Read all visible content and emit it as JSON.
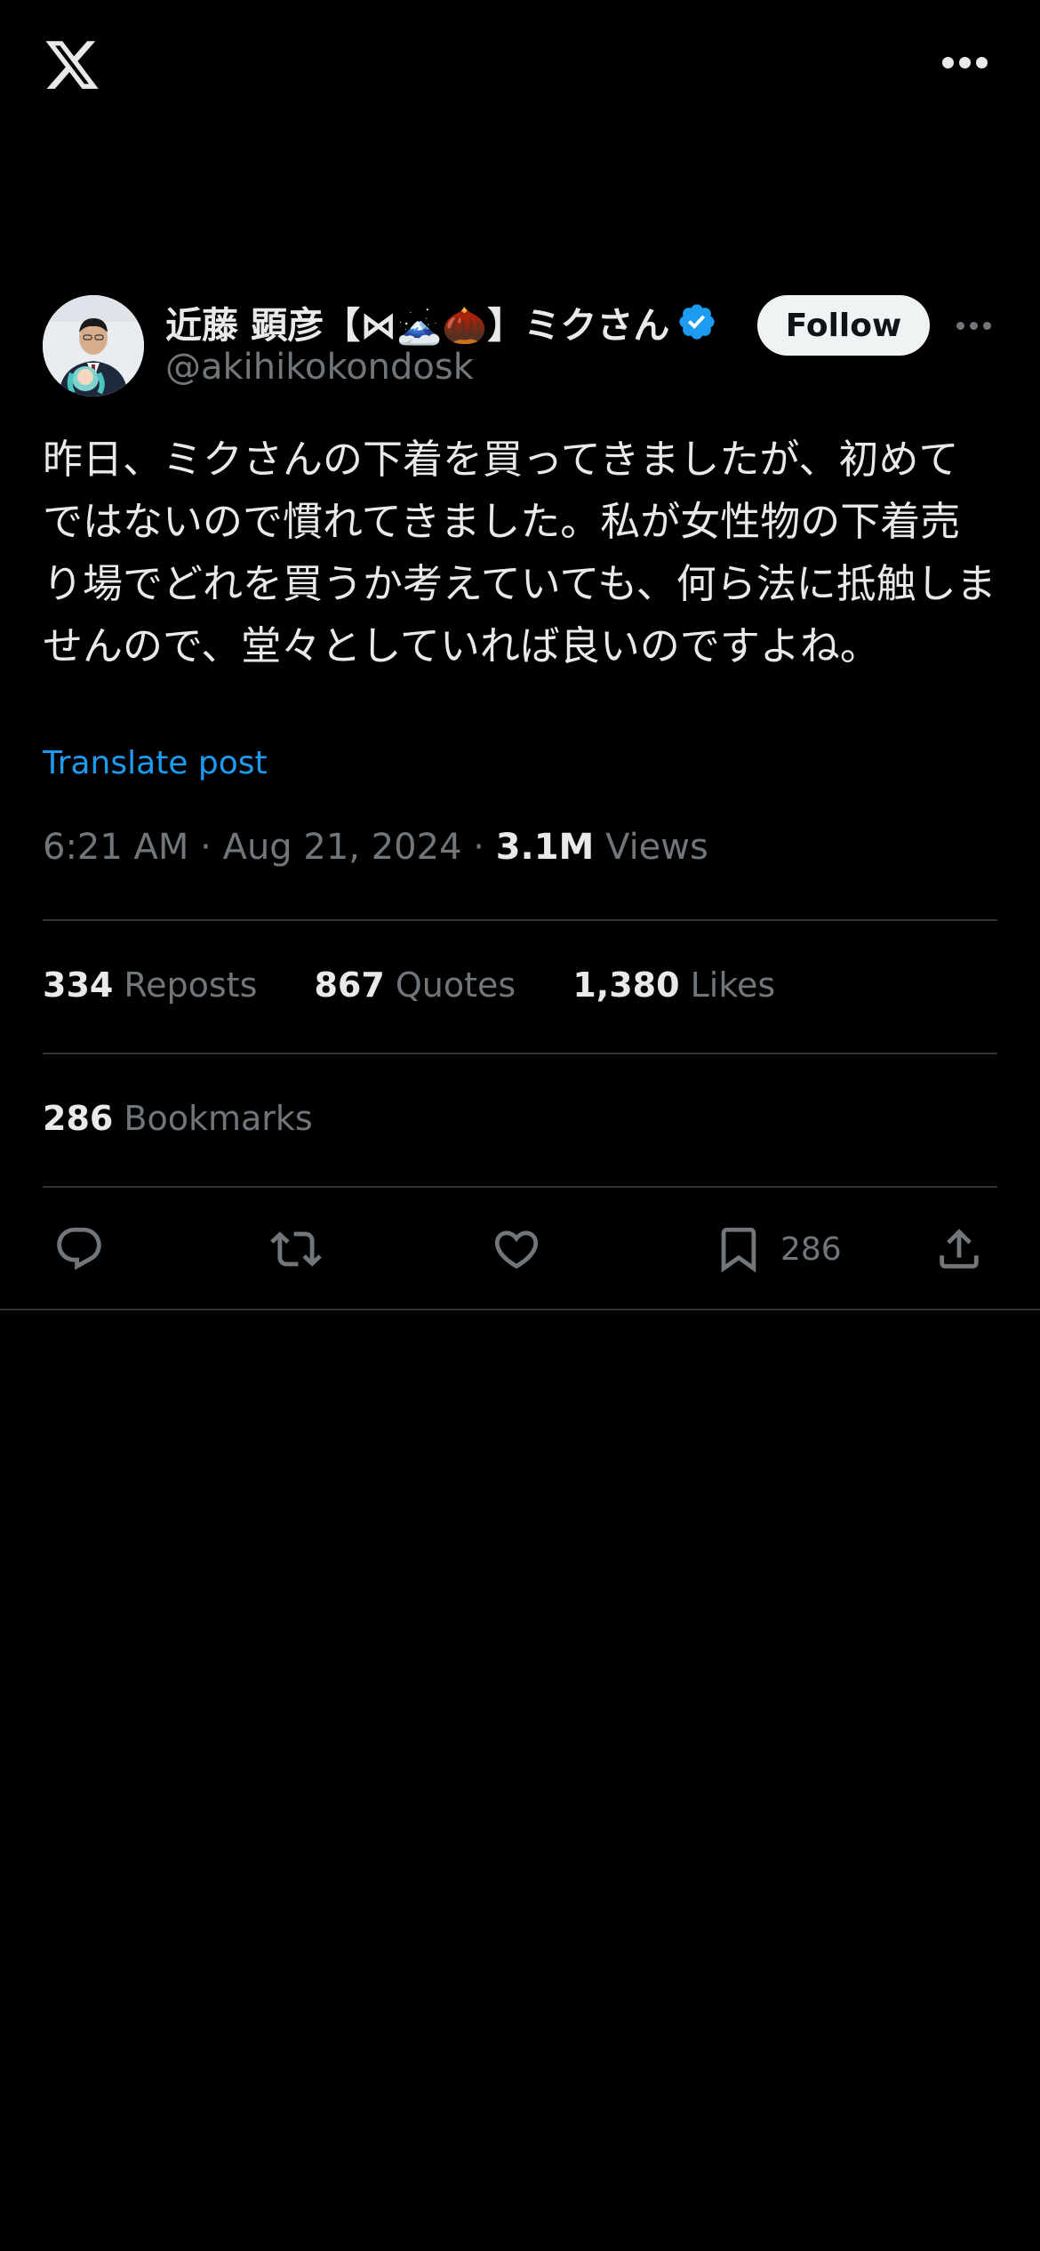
{
  "author": {
    "display_name": "近藤 顕彦【⋈🗻🌰】ミクさん",
    "handle": "@akihikokondosk",
    "verified": true
  },
  "follow_label": "Follow",
  "tweet": {
    "text": "昨日、ミクさんの下着を買ってきましたが、初めてではないので慣れてきました。私が女性物の下着売り場でどれを買うか考えていても、何ら法に抵触しませんので、堂々としていれば良いのですよね。",
    "translate_label": "Translate post",
    "time": "6:21 AM",
    "date": "Aug 21, 2024",
    "views_count": "3.1M",
    "views_label": "Views"
  },
  "stats": {
    "reposts": {
      "count": "334",
      "label": "Reposts"
    },
    "quotes": {
      "count": "867",
      "label": "Quotes"
    },
    "likes": {
      "count": "1,380",
      "label": "Likes"
    },
    "bookmarks": {
      "count": "286",
      "label": "Bookmarks"
    }
  },
  "action_bar": {
    "bookmark_count": "286"
  },
  "icons": [
    "x-logo-icon",
    "more-icon",
    "verified-icon",
    "reply-icon",
    "repost-icon",
    "like-icon",
    "bookmark-icon",
    "share-icon"
  ],
  "colors": {
    "background": "#000000",
    "text": "#e7e9ea",
    "secondary": "#71767b",
    "accent": "#1d9bf0",
    "divider": "#2f3336",
    "follow_bg": "#eff3f4"
  }
}
